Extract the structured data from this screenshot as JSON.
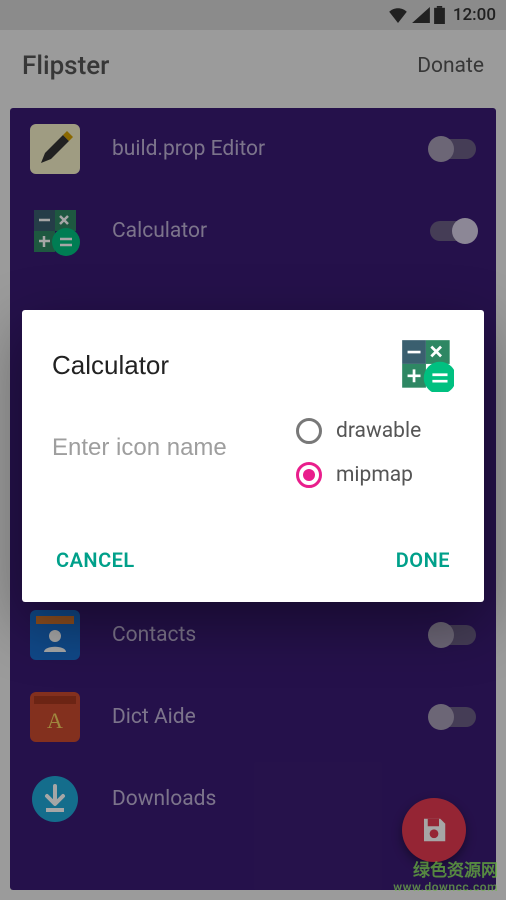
{
  "statusbar": {
    "time": "12:00"
  },
  "appbar": {
    "title": "Flipster",
    "donate": "Donate"
  },
  "list": [
    {
      "label": "build.prop Editor",
      "toggle": false
    },
    {
      "label": "Calculator",
      "toggle": true
    },
    {
      "label": "Contacts",
      "toggle": false
    },
    {
      "label": "Dict Aide",
      "toggle": false
    },
    {
      "label": "Downloads",
      "toggle": false
    }
  ],
  "dialog": {
    "name_value": "Calculator",
    "icon_placeholder": "Enter icon name",
    "radios": {
      "drawable": "drawable",
      "mipmap": "mipmap"
    },
    "selected": "mipmap",
    "cancel": "CANCEL",
    "done": "DONE"
  },
  "watermark": {
    "main": "绿色资源网",
    "sub": "www.downcc.com"
  }
}
